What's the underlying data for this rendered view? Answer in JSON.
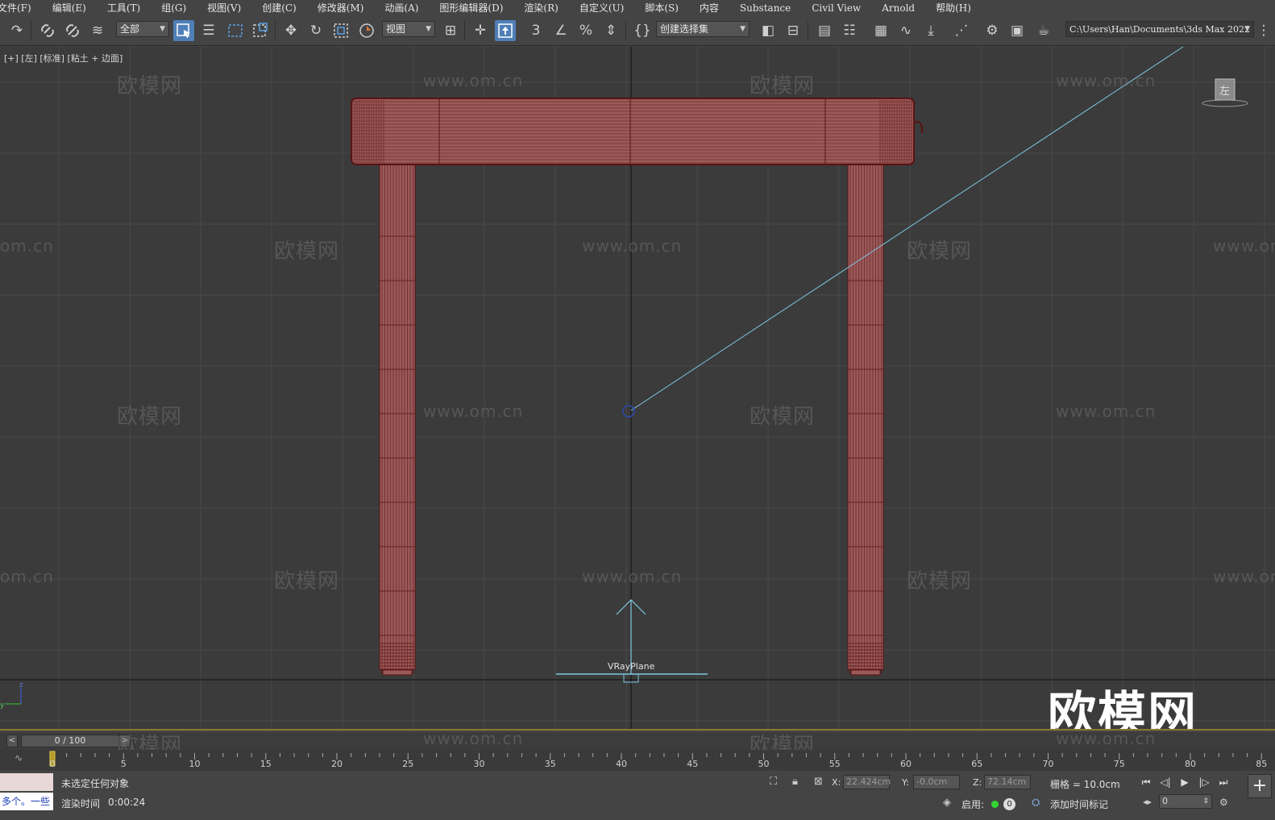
{
  "menubar": {
    "items": [
      "文件(F)",
      "编辑(E)",
      "工具(T)",
      "组(G)",
      "视图(V)",
      "创建(C)",
      "修改器(M)",
      "动画(A)",
      "图形编辑器(D)",
      "渲染(R)",
      "自定义(U)",
      "脚本(S)",
      "内容",
      "Substance",
      "Civil View",
      "Arnold",
      "帮助(H)"
    ]
  },
  "toolbar": {
    "selection_filter": "全部",
    "reference_coord": "视图",
    "named_selection": "创建选择集",
    "project_path": "C:\\Users\\Han\\Documents\\3ds Max 2022"
  },
  "viewport": {
    "label": "[+] [左] [标准] [粘土 + 边面]",
    "object_label": "VRayPlane",
    "viewcube_face": "左",
    "watermark_cn": "欧模网",
    "watermark_url": "www.om.cn",
    "watermark_url_partial": "om.cn",
    "brand_watermark": "欧模网",
    "colors": {
      "background": "#3b3b3b",
      "grid": "#4a4a4a",
      "object_fill": "#9a5a5a",
      "object_wire": "#5a1212",
      "helper": "#7ec8e3"
    }
  },
  "timeslider": {
    "frame_text": "0 / 100",
    "current_frame": 0,
    "total_frames": 100
  },
  "trackbar": {
    "ticks": [
      "0",
      "5",
      "10",
      "15",
      "20",
      "25",
      "30",
      "35",
      "40",
      "45",
      "50",
      "55",
      "60",
      "65",
      "70",
      "75",
      "80",
      "85"
    ]
  },
  "statusbar": {
    "maxscript_text": "多个。一些",
    "status": "未选定任何对象",
    "render_label": "渲染时间",
    "render_time": "0:00:24",
    "x_label": "X:",
    "x_value": "22.424cm",
    "y_label": "Y:",
    "y_value": "-0.0cm",
    "z_label": "Z:",
    "z_value": "72.14cm",
    "grid": "栅格 = 10.0cm",
    "enable_label": "启用:",
    "enable_count": "0",
    "add_time_tag": "添加时间标记",
    "frame_value": "0"
  }
}
